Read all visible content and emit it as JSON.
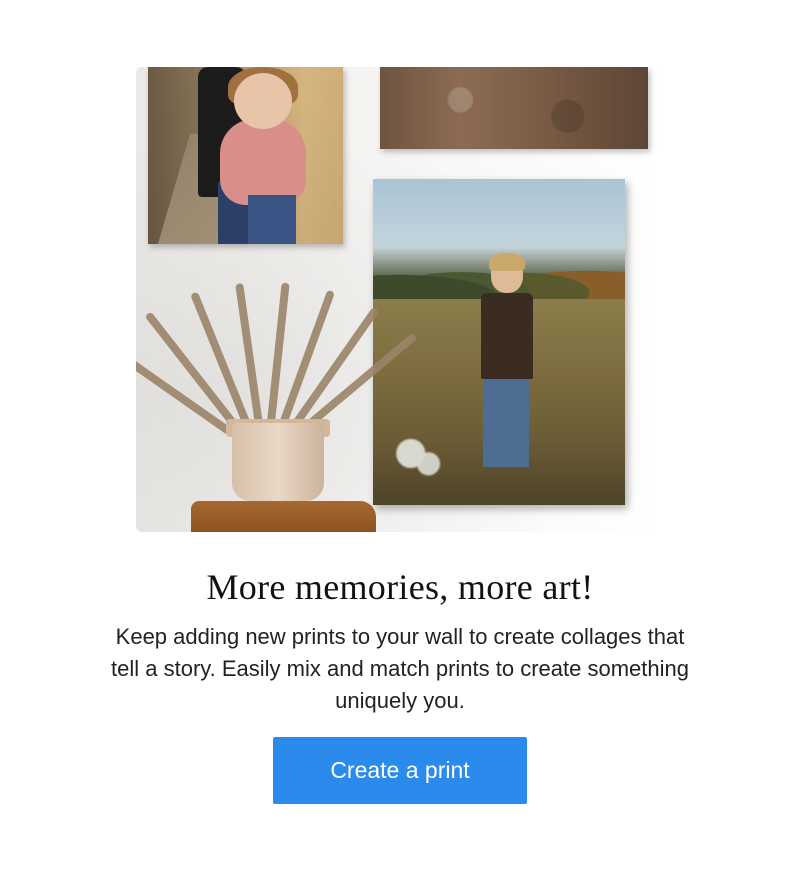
{
  "hero": {
    "image_description_icon": "photo-wall-image",
    "prints": [
      "hug-print",
      "ground-print",
      "field-print"
    ]
  },
  "content": {
    "headline": "More memories, more art!",
    "body": "Keep adding new prints to your wall to create collages that tell a story. Easily mix and match prints to create something uniquely you.",
    "cta_label": "Create a print"
  },
  "colors": {
    "cta_background": "#2b8bec",
    "cta_text": "#ffffff",
    "headline": "#111111",
    "body": "#222222",
    "page_background": "#ffffff"
  }
}
